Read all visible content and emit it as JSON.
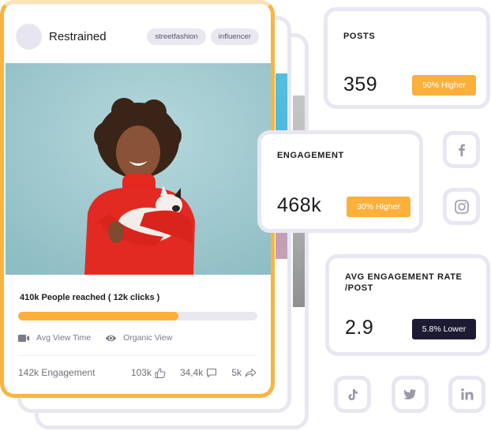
{
  "post": {
    "username": "Restrained",
    "tags": [
      "streetfashion",
      "influencer"
    ],
    "photo_alt": "woman in red sweater holding puppy",
    "reach_text": "410k People reached ( 12k clicks )",
    "reach_progress_percent": 67,
    "views": [
      {
        "icon": "video-camera-icon",
        "label": "Avg View Time"
      },
      {
        "icon": "eye-icon",
        "label": "Organic View"
      }
    ],
    "engagement_text": "142k Engagement",
    "stats": [
      {
        "icon": "thumbs-up-icon",
        "value": "103k"
      },
      {
        "icon": "comment-icon",
        "value": "34,4k"
      },
      {
        "icon": "share-icon",
        "value": "5k"
      }
    ]
  },
  "metrics": {
    "posts": {
      "title": "POSTS",
      "value": "359",
      "badge": "50% Higher",
      "trend": "up"
    },
    "engagement": {
      "title": "ENGAGEMENT",
      "value": "468k",
      "badge": "30% Higher",
      "trend": "up"
    },
    "avg_rate": {
      "title_line1": "AVG ENGAGEMENT RATE",
      "title_line2": "/POST",
      "value": "2.9",
      "badge": "5.8% Lower",
      "trend": "down"
    }
  },
  "social": [
    "facebook-icon",
    "instagram-icon",
    "tiktok-icon",
    "twitter-icon",
    "linkedin-icon"
  ],
  "colors": {
    "accent": "#fbb03b",
    "dark_badge": "#1d1a33",
    "border": "#e8e7f1",
    "icon_gray": "#9a99a8"
  }
}
